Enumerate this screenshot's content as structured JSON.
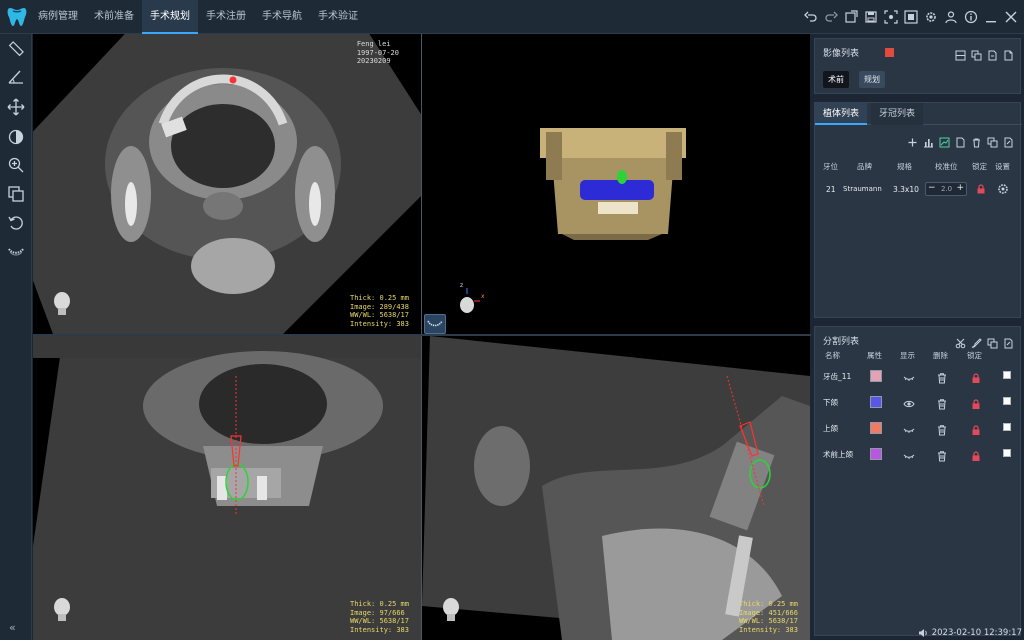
{
  "tabs": [
    {
      "label": "病例管理",
      "active": false
    },
    {
      "label": "术前准备",
      "active": false
    },
    {
      "label": "手术规划",
      "active": true
    },
    {
      "label": "手术注册",
      "active": false
    },
    {
      "label": "手术导航",
      "active": false
    },
    {
      "label": "手术验证",
      "active": false
    }
  ],
  "toolbar_icons": [
    "undo-icon",
    "redo-icon",
    "export-icon",
    "save-icon",
    "screenshot-icon",
    "capture-icon",
    "settings-icon",
    "user-icon",
    "info-icon",
    "minimize-icon",
    "close-icon"
  ],
  "left_tools": [
    "ruler-icon",
    "angle-icon",
    "move-icon",
    "contrast-icon",
    "zoom-icon",
    "layers-icon",
    "rotate-icon",
    "dental-arch-icon"
  ],
  "viewports": {
    "axial": {
      "patient_name": "Feng lei",
      "dob": "1997-07-20",
      "study": "20230209",
      "thick": "Thick: 0.25 mm",
      "image": "Image: 289/438",
      "wwwl": "WW/WL: 5638/17",
      "intensity": "Intensity: 383"
    },
    "coronal": {
      "thick": "Thick: 0.25 mm",
      "image": "Image: 97/666",
      "wwwl": "WW/WL: 5638/17",
      "intensity": "Intensity: 383"
    },
    "sagittal": {
      "thick": "Thick: 0.25 mm",
      "image": "Image: 451/666",
      "wwwl": "WW/WL: 5638/17",
      "intensity": "Intensity: 383"
    },
    "render3d": {
      "axis_x": "x",
      "axis_z": "z"
    }
  },
  "image_list": {
    "title": "影像列表",
    "accent": "#e24a3b",
    "chips": [
      "术前",
      "规划"
    ]
  },
  "implant_panel": {
    "tab_implant": "植体列表",
    "tab_crown": "牙冠列表",
    "columns": [
      "牙位",
      "品牌",
      "规格",
      "校准位",
      "锁定",
      "设置"
    ],
    "rows": [
      {
        "tooth": "21",
        "brand": "Straumann",
        "spec": "3.3x10",
        "calib": "2.0"
      }
    ]
  },
  "segment_panel": {
    "title": "分割列表",
    "columns": [
      "名称",
      "属性",
      "显示",
      "删除",
      "锁定"
    ],
    "rows": [
      {
        "name": "牙齿_11",
        "color": "#e3a3b4",
        "visible": false
      },
      {
        "name": "下颌",
        "color": "#5a57e8",
        "visible": true
      },
      {
        "name": "上颌",
        "color": "#f07a62",
        "visible": false
      },
      {
        "name": "术前上颌",
        "color": "#b957e0",
        "visible": false
      }
    ]
  },
  "status": {
    "datetime": "2023-02-10 12:39:17"
  }
}
